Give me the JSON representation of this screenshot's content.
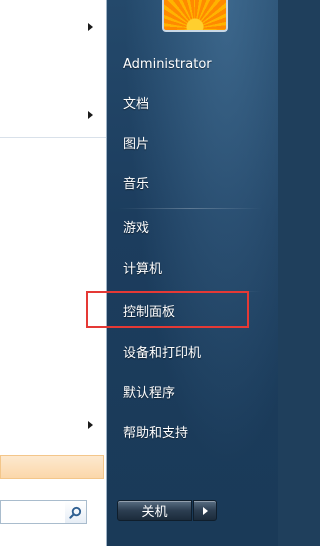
{
  "start_menu": {
    "right_items": [
      {
        "label": "Administrator"
      },
      {
        "label": "文档"
      },
      {
        "label": "图片"
      },
      {
        "label": "音乐"
      },
      {
        "label": "游戏"
      },
      {
        "label": "计算机"
      },
      {
        "label": "控制面板"
      },
      {
        "label": "设备和打印机"
      },
      {
        "label": "默认程序"
      },
      {
        "label": "帮助和支持"
      }
    ],
    "shutdown_label": "关机",
    "search": {
      "value": "",
      "placeholder": ""
    },
    "icons": {
      "submenu_arrow": "chevron-right-icon",
      "search": "search-icon",
      "shutdown_options": "arrow-right-icon"
    },
    "colors": {
      "highlight_box": "#e53935",
      "pane_background": "#1f3f5c"
    }
  }
}
